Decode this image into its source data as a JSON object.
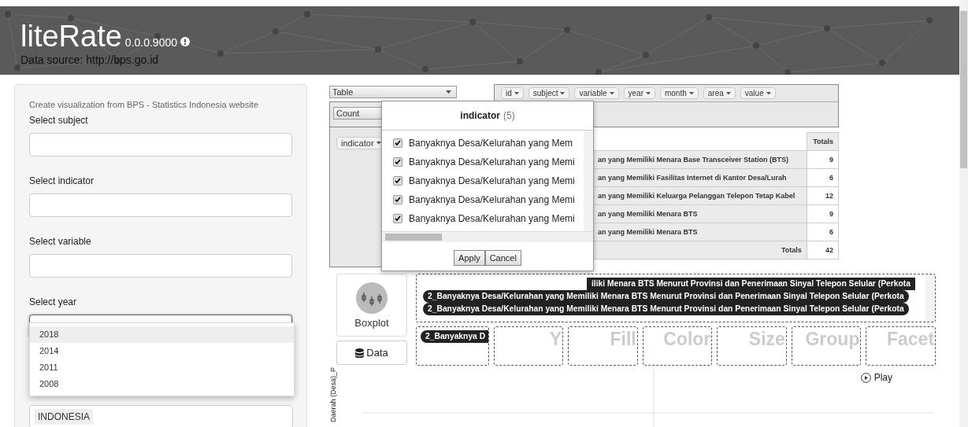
{
  "header": {
    "title": "liteRate",
    "version": "0.0.0.9000",
    "source": "Data source: http://bps.go.id"
  },
  "sidebar": {
    "intro": "Create visualization from BPS - Statistics Indonesia website",
    "fields": [
      {
        "label": "Select subject",
        "focused": false
      },
      {
        "label": "Select indicator",
        "focused": false
      },
      {
        "label": "Select variable",
        "focused": false
      },
      {
        "label": "Select year",
        "focused": true
      }
    ],
    "year_options": [
      {
        "label": "2018",
        "selected": true
      },
      {
        "label": "2014",
        "selected": false
      },
      {
        "label": "2011",
        "selected": false
      },
      {
        "label": "2008",
        "selected": false
      }
    ],
    "area_chips": [
      "INDONESIA"
    ]
  },
  "pivot": {
    "renderer": "Table",
    "aggregator": "Count",
    "attributes": [
      "id",
      "subject",
      "variable",
      "year",
      "month",
      "area",
      "value"
    ],
    "row_attribute": "indicator",
    "totals_header": "Totals",
    "rows": [
      {
        "label": "an yang Memiliki Menara Base Transceiver Station (BTS)",
        "total": "9"
      },
      {
        "label": "an yang Memiliki Fasilitas Internet di Kantor Desa/Lurah",
        "total": "6"
      },
      {
        "label": "an yang Memiliki Keluarga Pelanggan Telepon Tetap Kabel",
        "total": "12"
      },
      {
        "label": "an yang Memiliki Menara BTS",
        "total": "9"
      },
      {
        "label": "an yang Memiliki Menara BTS",
        "total": "6"
      }
    ],
    "totals_label": "Totals",
    "grand_total": "42"
  },
  "filter_popup": {
    "title": "indicator",
    "count": "(5)",
    "items": [
      {
        "label": "Banyaknya Desa/Kelurahan yang Mem",
        "checked": true
      },
      {
        "label": "Banyaknya Desa/Kelurahan yang Memi",
        "checked": true
      },
      {
        "label": "Banyaknya Desa/Kelurahan yang Memi",
        "checked": true
      },
      {
        "label": "Banyaknya Desa/Kelurahan yang Memi",
        "checked": true
      },
      {
        "label": "Banyaknya Desa/Kelurahan yang Memi",
        "checked": true
      }
    ],
    "buttons": [
      "Apply",
      "Cancel"
    ]
  },
  "chart_builder": {
    "geom": "Boxplot",
    "data_button": "Data",
    "variables": [
      {
        "label": "iliki Menara BTS Menurut Provinsi dan Penerimaan Sinyal Telepon Selular (Perkota",
        "partial": true
      },
      {
        "label": "2_Banyaknya Desa/Kelurahan yang Memiliki Menara BTS Menurut Provinsi dan Penerimaan Sinyal Telepon Selular (Perkota",
        "partial": false
      },
      {
        "label": "2_Banyaknya Desa/Kelurahan yang Memiliki Menara BTS Menurut Provinsi dan Penerimaan Sinyal Telepon Selular (Perkota",
        "partial": false
      }
    ],
    "x_chip": "2_Banyaknya D",
    "zones": [
      "Y",
      "Fill",
      "Color",
      "Size",
      "Group",
      "Facet"
    ],
    "play": "Play",
    "y_axis_label": "Daerah (Desa)_P"
  }
}
